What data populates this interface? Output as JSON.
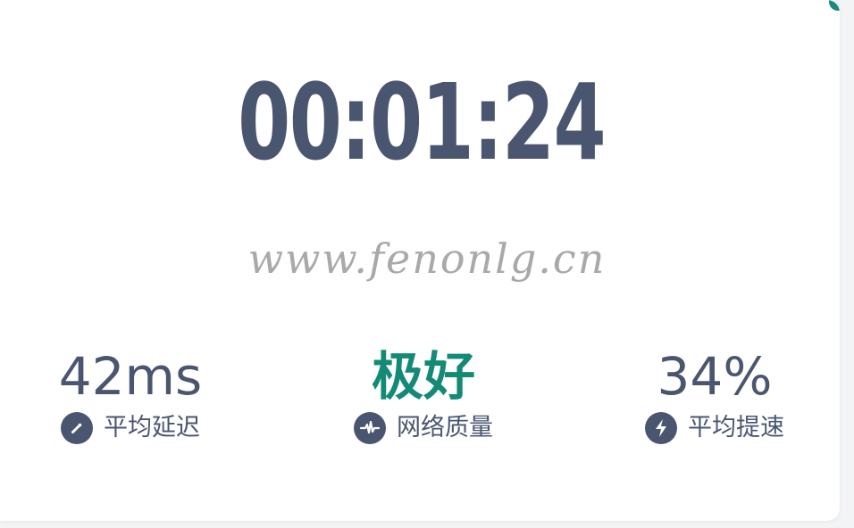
{
  "timer": {
    "elapsed": "00:01:24"
  },
  "watermark": {
    "text": "www.fenonlg.cn"
  },
  "colors": {
    "primary_text": "#4a5670",
    "quality_good": "#138a75",
    "accent_corner": "#1b8a7a"
  },
  "stats": [
    {
      "value": "42ms",
      "label": "平均延迟",
      "icon": "speedometer-icon"
    },
    {
      "value": "极好",
      "label": "网络质量",
      "icon": "pulse-wave-icon"
    },
    {
      "value": "34%",
      "label": "平均提速",
      "icon": "lightning-bolt-icon"
    }
  ]
}
